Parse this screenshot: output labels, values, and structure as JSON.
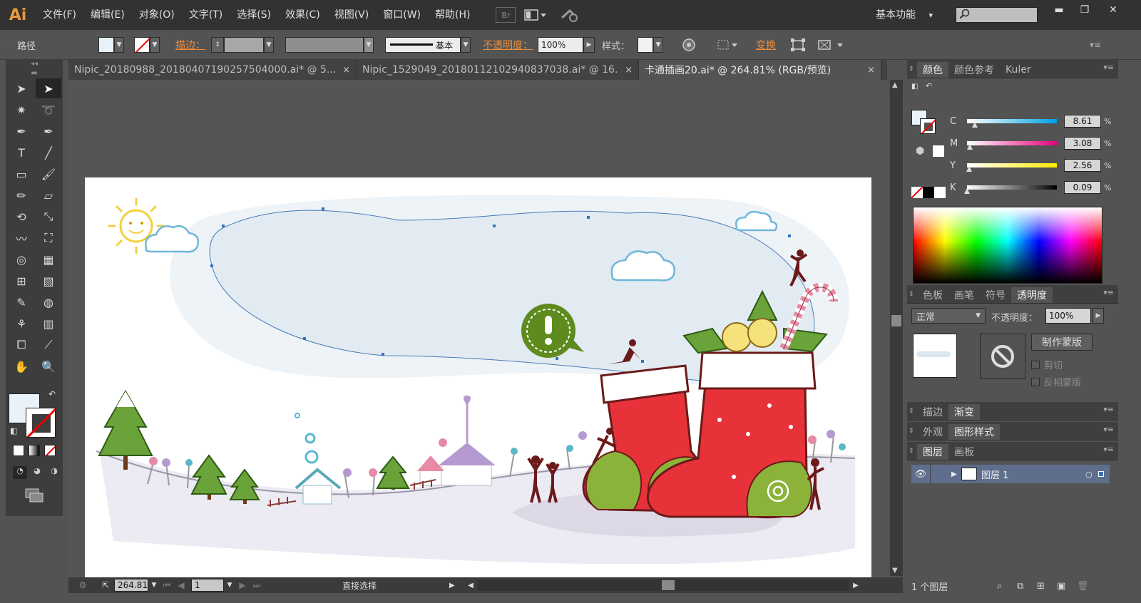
{
  "app": {
    "logo": "Ai"
  },
  "menu": [
    "文件(F)",
    "编辑(E)",
    "对象(O)",
    "文字(T)",
    "选择(S)",
    "效果(C)",
    "视图(V)",
    "窗口(W)",
    "帮助(H)"
  ],
  "menubar": {
    "bridge_label": "Br",
    "workspace": "基本功能",
    "workspace_arrow": "▾"
  },
  "window_controls": {
    "minimize": "▬",
    "maximize": "❐",
    "close": "✕"
  },
  "control_bar": {
    "selection_type": "路径",
    "stroke_label": "描边：",
    "stroke_style": "基本",
    "opacity_label": "不透明度：",
    "opacity_value": "100%",
    "style_label": "样式：",
    "transform_label": "变换"
  },
  "colors": {
    "fill": "#e8f2f8",
    "accent_orange": "#f08c35"
  },
  "tabs": [
    {
      "label": "Nipic_20180988_20180407190257504000.ai* @ 5..."
    },
    {
      "label": "Nipic_1529049_20180112102940837038.ai* @ 16...."
    },
    {
      "label": "卡通插画20.ai* @ 264.81% (RGB/预览)"
    }
  ],
  "tab_close": "×",
  "tools": [
    "selection-tool",
    "direct-selection-tool",
    "magic-wand-tool",
    "lasso-tool",
    "pen-tool",
    "curvature-tool",
    "type-tool",
    "line-tool",
    "rectangle-tool",
    "paintbrush-tool",
    "pencil-tool",
    "eraser-tool",
    "rotate-tool",
    "scale-tool",
    "warp-tool",
    "free-transform-tool",
    "shape-builder-tool",
    "graph-tool",
    "mesh-tool",
    "gradient-tool",
    "eyedropper-tool",
    "blend-tool",
    "symbol-sprayer-tool",
    "column-graph-tool",
    "artboard-tool",
    "slice-tool",
    "hand-tool",
    "zoom-tool"
  ],
  "status": {
    "zoom": "264.81",
    "artboard_number": "1",
    "current_tool": "直接选择"
  },
  "color_panel": {
    "tabs": [
      "颜色",
      "颜色参考",
      "Kuler"
    ],
    "channels": [
      {
        "label": "C",
        "value": "8.61",
        "fraction": 0.0861,
        "gradient": "linear-gradient(to right,#ffffff,#00a0e6)"
      },
      {
        "label": "M",
        "value": "3.08",
        "fraction": 0.0308,
        "gradient": "linear-gradient(to right,#ffffff,#e6007e)"
      },
      {
        "label": "Y",
        "value": "2.56",
        "fraction": 0.0256,
        "gradient": "linear-gradient(to right,#ffffff,#ffec00)"
      },
      {
        "label": "K",
        "value": "0.09",
        "fraction": 0.0009,
        "gradient": "linear-gradient(to right,#ffffff,#000000)"
      }
    ],
    "percent_sign": "%"
  },
  "transparency_panel": {
    "tabs": [
      "色板",
      "画笔",
      "符号",
      "透明度"
    ],
    "blend_mode": "正常",
    "opacity_label": "不透明度：",
    "opacity_value": "100%",
    "make_mask_button": "制作蒙版",
    "clip_label": "剪切",
    "invert_mask_label": "反相蒙版"
  },
  "stroke_gradient_panel": {
    "tabs": [
      "描边",
      "渐变"
    ]
  },
  "appearance_panel": {
    "tabs": [
      "外观",
      "图形样式"
    ]
  },
  "layers_panel": {
    "tabs": [
      "图层",
      "画板"
    ],
    "layers": [
      {
        "name": "图层 1"
      }
    ],
    "count_label": "1 个图层"
  }
}
